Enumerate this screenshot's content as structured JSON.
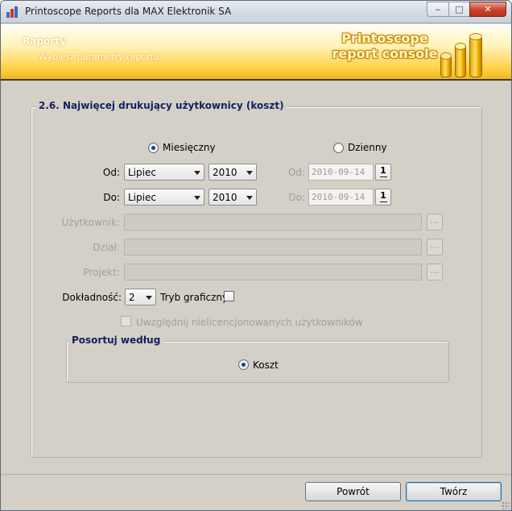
{
  "window": {
    "title": "Printoscope Reports dla MAX Elektronik SA",
    "minimize_glyph": "‒",
    "maximize_glyph": "□",
    "close_glyph": "✕"
  },
  "header": {
    "title": "Raporty",
    "subtitle": "Wybierz parametry raportu",
    "logo_line1": "Printoscope",
    "logo_line2": "report console"
  },
  "report": {
    "group_title": "2.6. Najwięcej drukujący użytkownicy (koszt)",
    "period": {
      "monthly_label": "Miesięczny",
      "daily_label": "Dzienny",
      "selected": "monthly"
    },
    "from": {
      "label": "Od:",
      "month": "Lipiec",
      "year": "2010",
      "date_label": "Od:",
      "date": "2010-09-14"
    },
    "to": {
      "label": "Do:",
      "month": "Lipiec",
      "year": "2010",
      "date_label": "Do:",
      "date": "2010-09-14"
    },
    "calendar_button": "1",
    "browse_button": "...",
    "user_label": "Użytkownik:",
    "department_label": "Dział:",
    "project_label": "Projekt:",
    "precision_label": "Dokładność:",
    "precision_value": "2",
    "graphic_mode_label": "Tryb graficzny",
    "graphic_mode_checked": false,
    "unlicensed_label": "Uwzględnij nielicencjonowanych użytkowników",
    "unlicensed_checked": false,
    "sort": {
      "title": "Posortuj według",
      "option_label": "Koszt"
    }
  },
  "footer": {
    "back_label": "Powrót",
    "create_label": "Twórz"
  },
  "colors": {
    "header_accent": "#ffd24a",
    "group_title": "#14205e",
    "window_bg": "#d4d0c8"
  }
}
